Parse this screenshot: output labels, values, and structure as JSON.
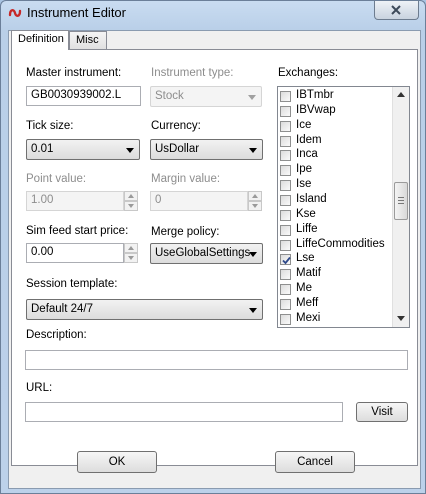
{
  "window": {
    "title": "Instrument Editor"
  },
  "tabs": [
    {
      "label": "Definition"
    },
    {
      "label": "Misc"
    }
  ],
  "fields": {
    "master_instrument": {
      "label": "Master instrument:",
      "value": "GB0030939002.L"
    },
    "instrument_type": {
      "label": "Instrument type:",
      "value": "Stock"
    },
    "tick_size": {
      "label": "Tick size:",
      "value": "0.01"
    },
    "currency": {
      "label": "Currency:",
      "value": "UsDollar"
    },
    "point_value": {
      "label": "Point value:",
      "value": "1.00"
    },
    "margin_value": {
      "label": "Margin value:",
      "value": "0"
    },
    "sim_feed_start_price": {
      "label": "Sim feed start price:",
      "value": "0.00"
    },
    "merge_policy": {
      "label": "Merge policy:",
      "value": "UseGlobalSettings"
    },
    "session_template": {
      "label": "Session template:",
      "value": "Default 24/7"
    },
    "description": {
      "label": "Description:",
      "value": ""
    },
    "url": {
      "label": "URL:",
      "value": ""
    }
  },
  "exchanges": {
    "label": "Exchanges:",
    "items": [
      {
        "name": "IBTmbr",
        "checked": false
      },
      {
        "name": "IBVwap",
        "checked": false
      },
      {
        "name": "Ice",
        "checked": false
      },
      {
        "name": "Idem",
        "checked": false
      },
      {
        "name": "Inca",
        "checked": false
      },
      {
        "name": "Ipe",
        "checked": false
      },
      {
        "name": "Ise",
        "checked": false
      },
      {
        "name": "Island",
        "checked": false
      },
      {
        "name": "Kse",
        "checked": false
      },
      {
        "name": "Liffe",
        "checked": false
      },
      {
        "name": "LiffeCommodities",
        "checked": false
      },
      {
        "name": "Lse",
        "checked": true
      },
      {
        "name": "Matif",
        "checked": false
      },
      {
        "name": "Me",
        "checked": false
      },
      {
        "name": "Meff",
        "checked": false
      },
      {
        "name": "Mexi",
        "checked": false
      }
    ]
  },
  "buttons": {
    "visit": "Visit",
    "ok": "OK",
    "cancel": "Cancel"
  },
  "icons": {
    "app": "ninja-logo-icon",
    "close": "close-icon"
  }
}
